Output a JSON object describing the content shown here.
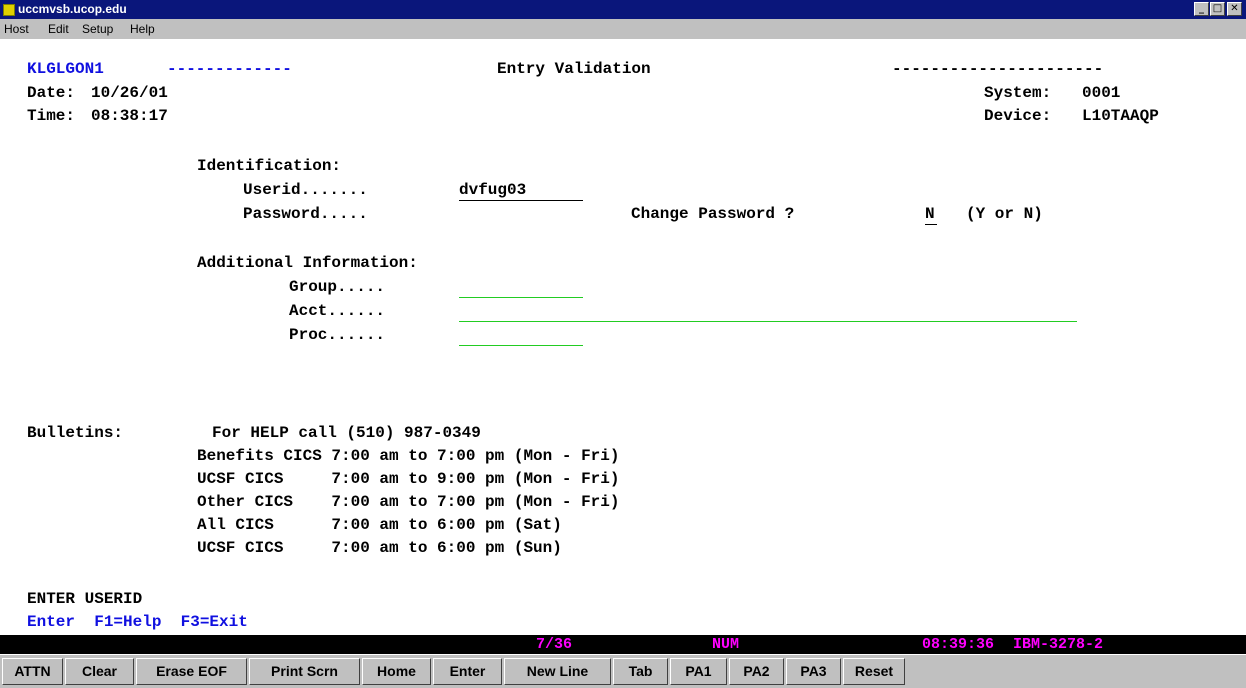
{
  "window": {
    "title": "uccmvsb.ucop.edu",
    "icon": "terminal-app-icon"
  },
  "menu": {
    "host": "Host",
    "edit": "Edit",
    "setup": "Setup",
    "help": "Help"
  },
  "screen": {
    "screen_id": "KLGLGON1",
    "dashes_left": "-------------",
    "title": "Entry Validation",
    "dashes_right": "----------------------",
    "date_label": "Date:",
    "date_value": "10/26/01",
    "time_label": "Time:",
    "time_value": "08:38:17",
    "system_label": "System:",
    "system_value": "0001",
    "device_label": "Device:",
    "device_value": "L10TAAQP",
    "identification_heading": "Identification:",
    "userid_label": "Userid.......",
    "userid_value": "dvfug03",
    "password_label": "Password.....",
    "change_password_label": "Change Password ?",
    "change_password_value": "N",
    "change_password_hint": "(Y or N)",
    "additional_heading": "Additional Information:",
    "group_label": "Group.....",
    "acct_label": "Acct......",
    "proc_label": "Proc......",
    "bulletins_label": "Bulletins:",
    "bulletins": [
      "For HELP call (510) 987-0349",
      "Benefits CICS 7:00 am to 7:00 pm (Mon - Fri)",
      "UCSF CICS     7:00 am to 9:00 pm (Mon - Fri)",
      "Other CICS    7:00 am to 7:00 pm (Mon - Fri)",
      "All CICS      7:00 am to 6:00 pm (Sat)",
      "UCSF CICS     7:00 am to 6:00 pm (Sun)"
    ],
    "message": "ENTER USERID",
    "pf_keys": "Enter  F1=Help  F3=Exit"
  },
  "status": {
    "cursor": "7/36",
    "num": "NUM",
    "clock": "08:39:36",
    "terminal": "IBM-3278-2"
  },
  "keys": [
    "ATTN",
    "Clear",
    "Erase EOF",
    "Print Scrn",
    "Home",
    "Enter",
    "New Line",
    "Tab",
    "PA1",
    "PA2",
    "PA3",
    "Reset"
  ],
  "colors": {
    "title_bar": "#0a167b",
    "screen_bg": "#ffffff",
    "protected_text": "#000000",
    "highlight_text": "#1010e0",
    "input_underline": "#22cc22",
    "status_text": "#ff00ff"
  }
}
